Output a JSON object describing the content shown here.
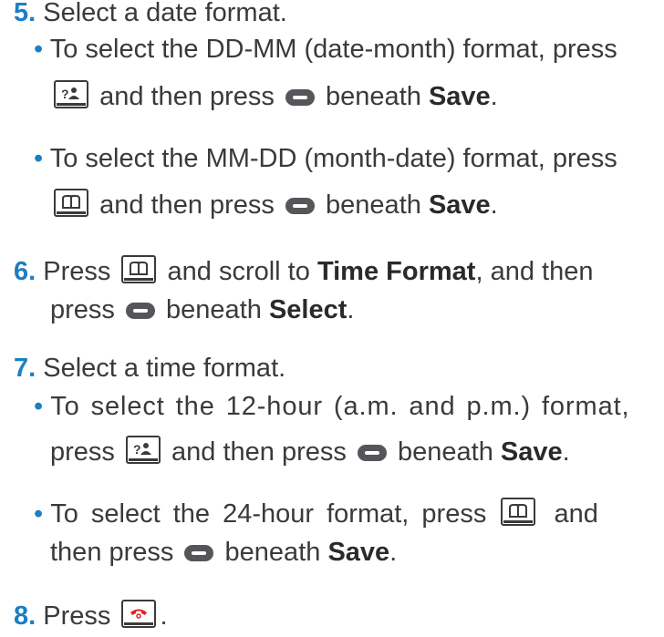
{
  "steps": [
    {
      "num": "5.",
      "text": "Select a date format."
    },
    {
      "num": "6.",
      "pre": "Press",
      "mid": "and scroll to",
      "bold1": "Time Format",
      "mid2": ", and then",
      "line2_pre": "press",
      "line2_mid": "beneath",
      "bold2": "Select",
      "end": "."
    },
    {
      "num": "7.",
      "text": "Select a time format."
    },
    {
      "num": "8.",
      "pre": "Press",
      "end": "."
    }
  ],
  "date_bullets": [
    {
      "line1": "To select the DD-MM (date-month) format, press",
      "line2_mid": "and then press",
      "line2_after": "beneath",
      "bold": "Save",
      "end": "."
    },
    {
      "line1": "To select the MM-DD (month-date) format, press",
      "line2_mid": "and then press",
      "line2_after": "beneath",
      "bold": "Save",
      "end": "."
    }
  ],
  "time_bullets": [
    {
      "line1": "To select the 12-hour (a.m. and p.m.) format,",
      "line2_pre": "press",
      "line2_mid": "and then press",
      "line2_after": "beneath",
      "bold": "Save",
      "end": "."
    },
    {
      "line1": "To select the 24-hour format, press",
      "line1_after": "and",
      "line2_pre": "then press",
      "line2_after": "beneath",
      "bold": "Save",
      "end": "."
    }
  ],
  "bullet_char": "•",
  "icons": {
    "star_key": "star-key-icon",
    "book_key": "phonebook-key-icon",
    "soft_key": "soft-key-icon",
    "end_key": "end-call-key-icon"
  },
  "colors": {
    "accent": "#1c7fc4",
    "text": "#3a3a3c",
    "end_call": "#e0242a"
  }
}
